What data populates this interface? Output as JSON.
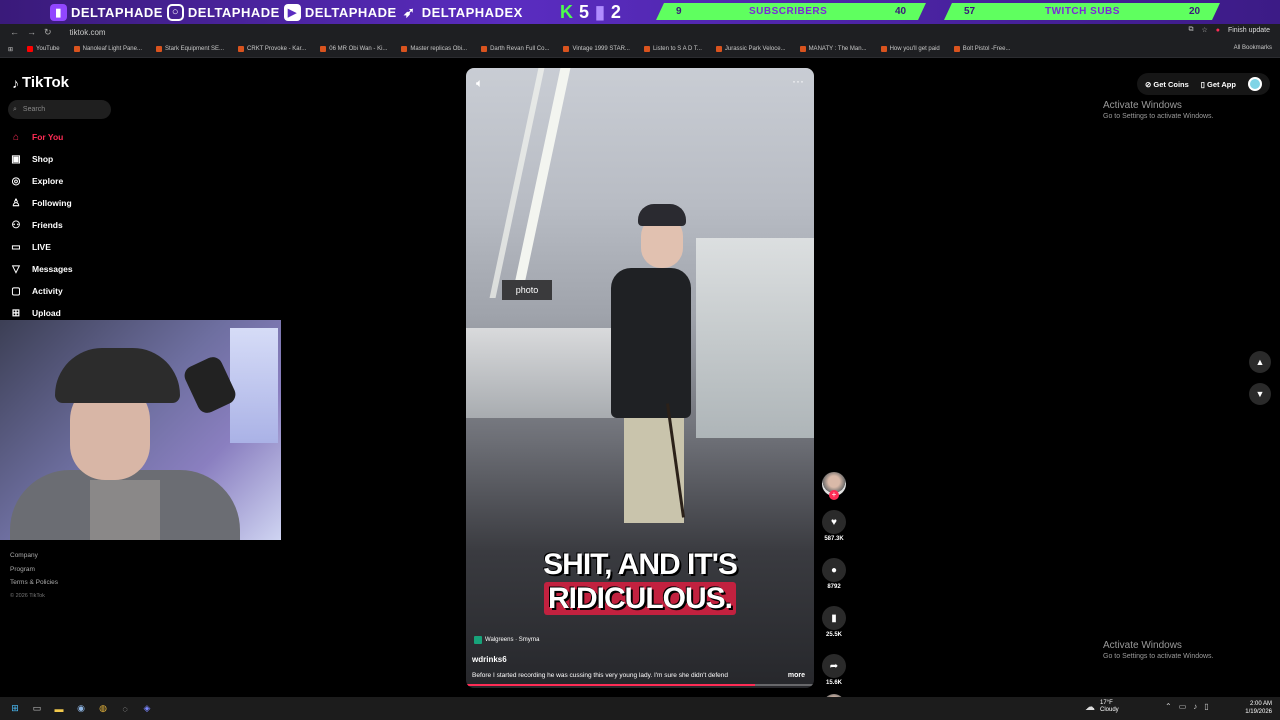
{
  "overlay": {
    "handles": [
      "DELTAPHADE",
      "DELTAPHADE",
      "DELTAPHADE",
      "DELTAPHADEX"
    ],
    "kick_count": "5",
    "twitch_count": "2",
    "subscribers": {
      "label": "SUBSCRIBERS",
      "current": "9",
      "goal": "40"
    },
    "twitch_subs": {
      "label": "TWITCH SUBS",
      "current": "57",
      "goal": "20"
    }
  },
  "browser": {
    "url": "tiktok.com",
    "relaunch": "Finish update",
    "bookmarks": [
      "YouTube",
      "Nanoleaf Light Pane...",
      "Stark Equipment SE...",
      "CRKT Provoke - Kar...",
      "06 MR Obi Wan - Ki...",
      "Master replicas Obi...",
      "Darth Revan Full Co...",
      "Vintage 1999 STAR...",
      "Listen to S A D T...",
      "Jurassic Park Veloce...",
      "MANATY : The Man...",
      "How you'll get paid",
      "Bolt Pistol -Free..."
    ],
    "all_bookmarks": "All Bookmarks"
  },
  "sidebar": {
    "logo": "TikTok",
    "search_placeholder": "Search",
    "items": [
      {
        "label": "For You",
        "icon": "home-icon",
        "glyph": "⌂"
      },
      {
        "label": "Shop",
        "icon": "shop-icon",
        "glyph": "▣"
      },
      {
        "label": "Explore",
        "icon": "compass-icon",
        "glyph": "◎"
      },
      {
        "label": "Following",
        "icon": "following-icon",
        "glyph": "♙"
      },
      {
        "label": "Friends",
        "icon": "friends-icon",
        "glyph": "⚇"
      },
      {
        "label": "LIVE",
        "icon": "live-icon",
        "glyph": "▭"
      },
      {
        "label": "Messages",
        "icon": "messages-icon",
        "glyph": "▽"
      },
      {
        "label": "Activity",
        "icon": "activity-icon",
        "glyph": "▢"
      },
      {
        "label": "Upload",
        "icon": "upload-icon",
        "glyph": "⊞"
      }
    ],
    "footer": {
      "company": "Company",
      "program": "Program",
      "terms": "Terms & Policies",
      "copyright": "© 2026 TikTok"
    }
  },
  "video": {
    "caption_a": "SHIT, AND IT'S ",
    "caption_b": "RIDICULOUS.",
    "location": "Walgreens · Smyrna",
    "username": "wdrinks6",
    "description": "Before I started recording he was cussing this very young lady. I'm sure she didn't defend",
    "more": "more",
    "progress": 0.83,
    "sign": "photo"
  },
  "actions": {
    "likes": "587.3K",
    "comments": "8792",
    "saves": "25.5K",
    "shares": "15.6K"
  },
  "topbar": {
    "get_coins": "Get Coins",
    "get_app": "Get App"
  },
  "watermark": {
    "title": "Activate Windows",
    "subtitle": "Go to Settings to activate Windows."
  },
  "taskbar": {
    "temp": "17°F",
    "weather": "Cloudy",
    "time": "2:00 AM",
    "date": "1/19/2026"
  },
  "colors": {
    "accent": "#fe2c55",
    "overlay_bar": "#5fff5f"
  }
}
